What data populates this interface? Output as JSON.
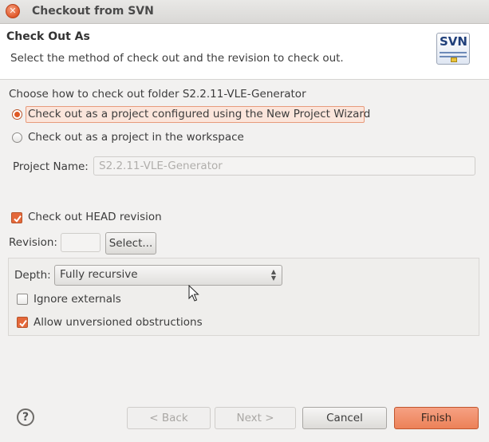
{
  "window": {
    "title": "Checkout from SVN",
    "close_icon": "close-icon"
  },
  "header": {
    "title": "Check Out As",
    "description": "Select the method of check out and the revision to check out.",
    "logo_text": "SVN"
  },
  "method": {
    "label": "Choose how to check out folder S2.2.11-VLE-Generator",
    "option_wizard": {
      "label": "Check out as a project configured using the New Project Wizard",
      "selected": true
    },
    "option_workspace": {
      "label": "Check out as a project in the workspace",
      "selected": false
    }
  },
  "project_name": {
    "label": "Project Name:",
    "value": "S2.2.11-VLE-Generator"
  },
  "revision": {
    "head_label": "Check out HEAD revision",
    "head_checked": true,
    "label": "Revision:",
    "value": "",
    "select_button": "Select..."
  },
  "options": {
    "depth_label": "Depth:",
    "depth_value": "Fully recursive",
    "ignore_externals": {
      "label": "Ignore externals",
      "checked": false
    },
    "allow_unversioned": {
      "label": "Allow unversioned obstructions",
      "checked": true
    }
  },
  "footer": {
    "back": "< Back",
    "next": "Next >",
    "cancel": "Cancel",
    "finish": "Finish"
  },
  "colors": {
    "accent": "#e4683a",
    "selection_bg": "#fbe5db"
  }
}
